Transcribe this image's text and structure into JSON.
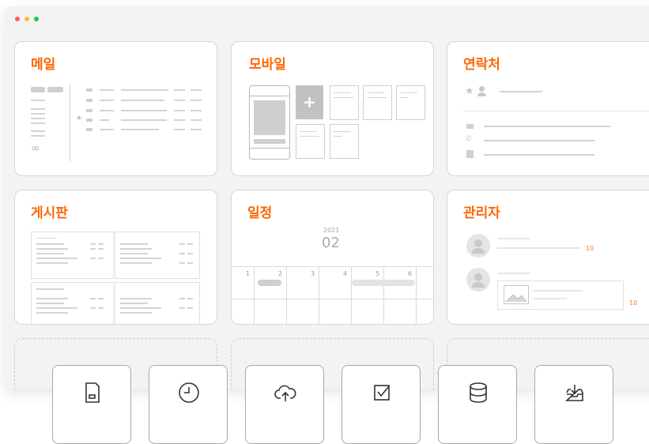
{
  "window_dots": [
    "#ff5f57",
    "#febc2e",
    "#28c840"
  ],
  "accent_color": "#ff6600",
  "cards": {
    "mail": {
      "title": "메일"
    },
    "mobile": {
      "title": "모바일"
    },
    "contacts": {
      "title": "연락처"
    },
    "board": {
      "title": "게시판"
    },
    "calendar": {
      "title": "일정",
      "year": "2021",
      "month": "02",
      "days": [
        "1",
        "2",
        "3",
        "4",
        "5",
        "6"
      ]
    },
    "admin": {
      "title": "관리자",
      "badge_1": "10",
      "badge_2": "10"
    }
  },
  "toolbar": {
    "items": [
      {
        "icon": "sd-card-icon"
      },
      {
        "icon": "clock-icon"
      },
      {
        "icon": "cloud-upload-icon"
      },
      {
        "icon": "checkbox-icon"
      },
      {
        "icon": "database-icon"
      },
      {
        "icon": "inbox-download-icon"
      }
    ]
  }
}
